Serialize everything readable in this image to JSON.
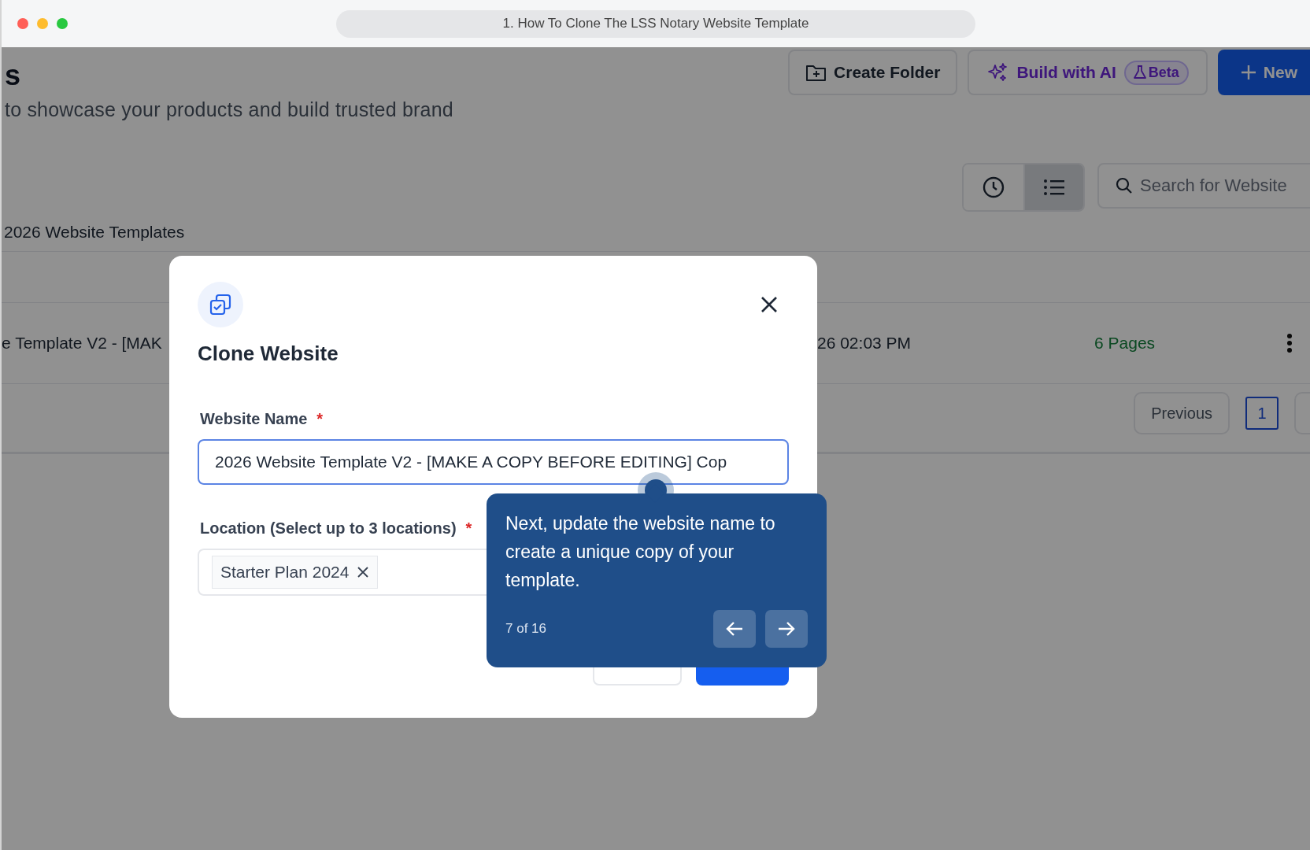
{
  "window": {
    "title": "1. How To Clone The LSS Notary Website Template"
  },
  "page": {
    "title": "s",
    "subtitle": "to showcase your products and build trusted brand",
    "actions": [
      {
        "kind": "folder",
        "label": "Create Folder"
      },
      {
        "kind": "ai",
        "label": "Build with AI",
        "badge": "Beta"
      },
      {
        "kind": "primary",
        "label": "New"
      }
    ],
    "view_toggles": [
      {
        "kind": "clock",
        "selected": false
      },
      {
        "kind": "list",
        "selected": true
      }
    ],
    "search": {
      "placeholder": "Search for Website"
    },
    "section_title": "2026 Website Templates",
    "table": {
      "rows": [
        {
          "name": "e Template V2 - [MAK",
          "date": "26 02:03 PM",
          "pages": "6 Pages"
        }
      ]
    },
    "pagination": {
      "previous": "Previous",
      "pages": [
        {
          "label": "1",
          "selected": true
        }
      ]
    }
  },
  "dialog": {
    "title": "Clone Website",
    "fields": [
      {
        "kind": "text",
        "label": "Website Name",
        "marker": "*",
        "value": "2026 Website Template V2 - [MAKE A COPY BEFORE EDITING] Cop"
      },
      {
        "kind": "tags",
        "label": "Location (Select up to 3 locations)",
        "marker": "*",
        "tags": [
          "Starter Plan 2024"
        ]
      }
    ]
  },
  "tour": {
    "text": "Next, update the website name to create a unique copy of your template.",
    "step": "7 of 16"
  }
}
